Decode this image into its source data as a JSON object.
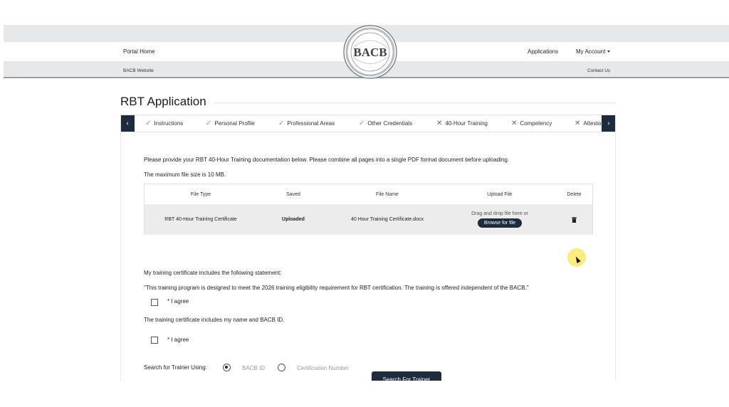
{
  "header": {
    "portal_home": "Portal Home",
    "applications": "Applications",
    "my_account": "My Account",
    "bacb_website": "BACB Website",
    "contact_us": "Contact Us",
    "logo_text": "BACB"
  },
  "page": {
    "title": "RBT Application"
  },
  "steps": [
    {
      "label": "Instructions",
      "status": "complete"
    },
    {
      "label": "Personal Profile",
      "status": "complete"
    },
    {
      "label": "Professional Areas",
      "status": "complete"
    },
    {
      "label": "Other Credentials",
      "status": "complete"
    },
    {
      "label": "40-Hour Training",
      "status": "incomplete"
    },
    {
      "label": "Competency",
      "status": "incomplete"
    },
    {
      "label": "Attesta",
      "status": "incomplete"
    }
  ],
  "content": {
    "instructions": "Please provide your RBT 40-Hour Training documentation below. Please combine all pages into a single PDF format document before uploading.",
    "max_size": "The maximum file size is 10 MB.",
    "table": {
      "headers": [
        "File Type",
        "Saved",
        "File Name",
        "Upload File",
        "Delete"
      ],
      "row": {
        "file_type": "RBT 40-Hour Training Certificate",
        "saved": "Uploaded",
        "file_name": "40 Hour Training Certificate.docx",
        "drop_text": "Drag and drop file here or",
        "browse_label": "Browse for file"
      }
    },
    "statement_intro": "My training certificate includes the following statement:",
    "statement": "\"This training program is designed to meet the 2026 training eligibility requirement for RBT certification. The training is offered independent of the BACB.\"",
    "agree_label": "* I agree",
    "name_id_text": "The training certificate includes my name and BACB ID.",
    "search_label": "Search for Trainer Using:",
    "option_bacb_id": "BACB ID",
    "option_cert_number": "Certification Number",
    "search_button": "Search For Trainer"
  },
  "colors": {
    "navy": "#1e2b3c",
    "check_green": "#6cb36c",
    "bar_grey": "#e6e8e9"
  }
}
